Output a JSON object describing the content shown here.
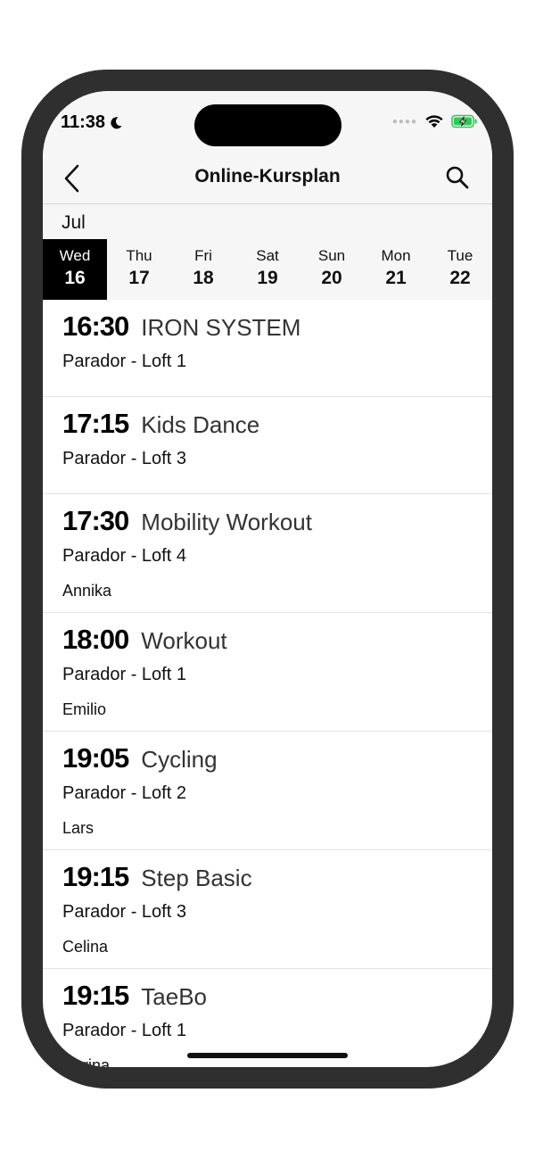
{
  "status": {
    "time": "11:38"
  },
  "nav": {
    "title": "Online-Kursplan"
  },
  "calendar": {
    "month": "Jul",
    "days": [
      {
        "name": "Wed",
        "num": "16"
      },
      {
        "name": "Thu",
        "num": "17"
      },
      {
        "name": "Fri",
        "num": "18"
      },
      {
        "name": "Sat",
        "num": "19"
      },
      {
        "name": "Sun",
        "num": "20"
      },
      {
        "name": "Mon",
        "num": "21"
      },
      {
        "name": "Tue",
        "num": "22"
      }
    ]
  },
  "classes": [
    {
      "time": "16:30",
      "name": "IRON SYSTEM",
      "location": "Parador - Loft 1",
      "trainer": ""
    },
    {
      "time": "17:15",
      "name": "Kids Dance",
      "location": "Parador - Loft 3",
      "trainer": ""
    },
    {
      "time": "17:30",
      "name": "Mobility Workout",
      "location": "Parador - Loft 4",
      "trainer": "Annika"
    },
    {
      "time": "18:00",
      "name": "Workout",
      "location": "Parador - Loft 1",
      "trainer": "Emilio"
    },
    {
      "time": "19:05",
      "name": "Cycling",
      "location": "Parador - Loft 2",
      "trainer": "Lars"
    },
    {
      "time": "19:15",
      "name": "Step Basic",
      "location": "Parador - Loft 3",
      "trainer": "Celina"
    },
    {
      "time": "19:15",
      "name": "TaeBo",
      "location": "Parador - Loft 1",
      "trainer": "Carina"
    }
  ],
  "colors": {
    "battery": "#34c759",
    "selected_day": "#000000"
  }
}
